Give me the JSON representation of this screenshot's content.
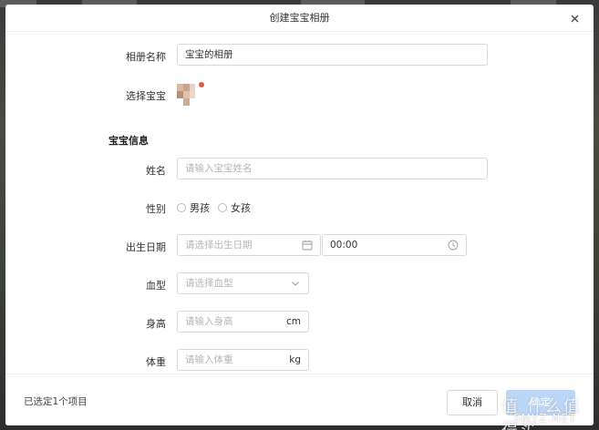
{
  "dialog": {
    "title": "创建宝宝相册",
    "close_glyph": "✕"
  },
  "album": {
    "name_label": "相册名称",
    "name_value": "宝宝的相册",
    "select_baby_label": "选择宝宝"
  },
  "baby_info": {
    "section_title": "宝宝信息",
    "name": {
      "label": "姓名",
      "placeholder": "请输入宝宝姓名"
    },
    "gender": {
      "label": "性别",
      "options": [
        "男孩",
        "女孩"
      ]
    },
    "birth": {
      "label": "出生日期",
      "date_placeholder": "请选择出生日期",
      "time_value": "00:00"
    },
    "blood": {
      "label": "血型",
      "placeholder": "请选择血型"
    },
    "height": {
      "label": "身高",
      "placeholder": "请输入身高",
      "unit": "cm"
    },
    "weight": {
      "label": "体重",
      "placeholder": "请输入体重",
      "unit": "kg"
    }
  },
  "footer": {
    "selected_text": "已选定1个项目",
    "cancel_label": "取消",
    "confirm_label": "确定"
  },
  "watermark": {
    "text": "值 什么值得买",
    "sub": "SMYZ.NET"
  },
  "colors": {
    "confirm_bg": "#bcd6f7",
    "badge": "#e05a4a"
  }
}
